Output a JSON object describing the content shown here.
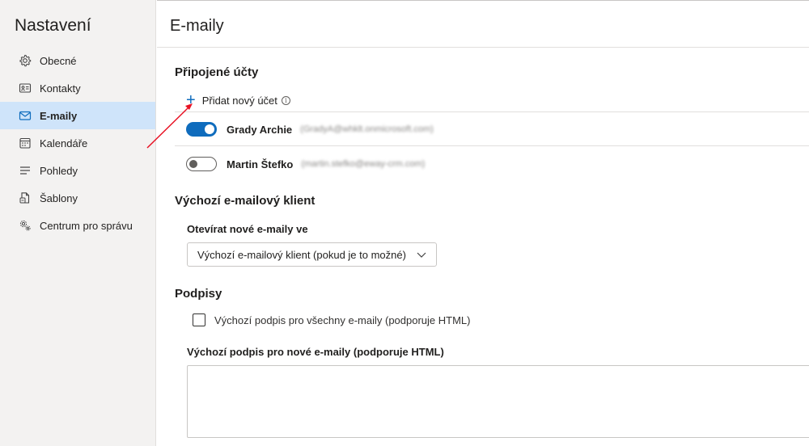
{
  "sidebar": {
    "title": "Nastavení",
    "items": [
      {
        "label": "Obecné",
        "icon": "gear-icon",
        "active": false
      },
      {
        "label": "Kontakty",
        "icon": "contact-card-icon",
        "active": false
      },
      {
        "label": "E-maily",
        "icon": "mail-icon",
        "active": true
      },
      {
        "label": "Kalendáře",
        "icon": "calendar-icon",
        "active": false
      },
      {
        "label": "Pohledy",
        "icon": "lines-icon",
        "active": false
      },
      {
        "label": "Šablony",
        "icon": "template-icon",
        "active": false
      },
      {
        "label": "Centrum pro správu",
        "icon": "admin-gear-icon",
        "active": false
      }
    ]
  },
  "main": {
    "title": "E-maily",
    "connected_accounts": {
      "heading": "Připojené účty",
      "add_label": "Přidat nový účet",
      "accounts": [
        {
          "name": "Grady Archie",
          "email": "(GradyA@whklt.onmicrosoft.com)",
          "enabled": true
        },
        {
          "name": "Martin Štefko",
          "email": "(martin.stefko@eway-crm.com)",
          "enabled": false
        }
      ]
    },
    "default_client": {
      "heading": "Výchozí e-mailový klient",
      "open_label": "Otevírat nové e-maily ve",
      "selected": "Výchozí e-mailový klient (pokud je to možné)"
    },
    "signatures": {
      "heading": "Podpisy",
      "checkbox_label": "Výchozí podpis pro všechny e-maily (podporuje HTML)",
      "checkbox_checked": false,
      "new_sig_label": "Výchozí podpis pro nové e-maily (podporuje HTML)"
    }
  },
  "colors": {
    "accent": "#0f6cbd",
    "active_nav": "#cfe4fa",
    "sidebar_bg": "#f3f2f1",
    "annotation_arrow": "#e81123"
  }
}
